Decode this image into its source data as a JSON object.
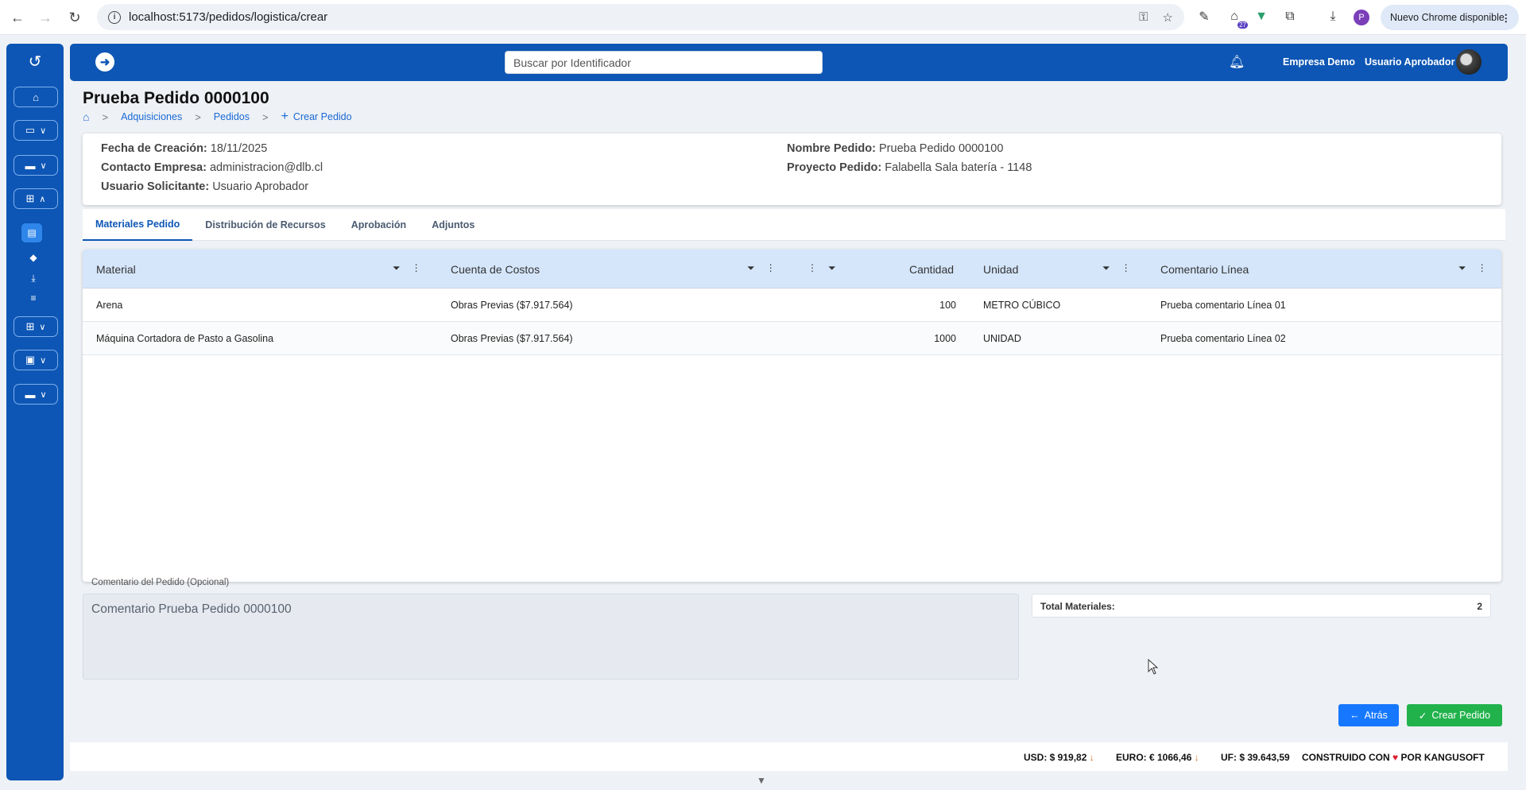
{
  "browser": {
    "url": "localhost:5173/pedidos/logistica/crear",
    "update_label": "Nuevo Chrome disponible",
    "profile_initial": "P",
    "ext_badge": "27"
  },
  "header": {
    "search_placeholder": "Buscar por Identificador",
    "company": "Empresa Demo",
    "user": "Usuario Aprobador"
  },
  "page": {
    "title": "Prueba Pedido 0000100",
    "breadcrumb": [
      "Adquisiciones",
      "Pedidos",
      "Crear Pedido"
    ]
  },
  "info": {
    "fecha_label": "Fecha de Creación:",
    "fecha_value": "18/11/2025",
    "contacto_label": "Contacto Empresa:",
    "contacto_value": "administracion@dlb.cl",
    "usuario_label": "Usuario Solicitante:",
    "usuario_value": "Usuario Aprobador",
    "nombre_label": "Nombre Pedido:",
    "nombre_value": "Prueba Pedido 0000100",
    "proyecto_label": "Proyecto Pedido:",
    "proyecto_value": "Falabella Sala batería - 1148"
  },
  "tabs": [
    "Materiales Pedido",
    "Distribución de Recursos",
    "Aprobación",
    "Adjuntos"
  ],
  "table": {
    "columns": [
      "Material",
      "Cuenta de Costos",
      "Cantidad",
      "Unidad",
      "Comentario Línea"
    ],
    "rows": [
      {
        "material": "Arena",
        "cuenta": "Obras Previas ($7.917.564)",
        "cantidad": "100",
        "unidad": "METRO CÚBICO",
        "comentario": "Prueba comentario Línea 01"
      },
      {
        "material": "Máquina Cortadora de Pasto a Gasolina",
        "cuenta": "Obras Previas ($7.917.564)",
        "cantidad": "1000",
        "unidad": "UNIDAD",
        "comentario": "Prueba comentario Línea 02"
      }
    ]
  },
  "comment": {
    "label": "Comentario del Pedido (Opcional)",
    "value": "Comentario Prueba Pedido 0000100"
  },
  "totals": {
    "label": "Total Materiales:",
    "value": "2"
  },
  "buttons": {
    "back": "Atrás",
    "create": "Crear Pedido"
  },
  "footer": {
    "usd": "USD: $ 919,82",
    "euro": "EURO: € 1066,46",
    "uf": "UF: $ 39.643,59",
    "built_prefix": "CONSTRUIDO CON",
    "built_suffix": "POR KANGUSOFT"
  },
  "colors": {
    "primary": "#0d56b5",
    "accent": "#1677ff",
    "success": "#22b24c",
    "header_row": "#d5e6fb"
  }
}
